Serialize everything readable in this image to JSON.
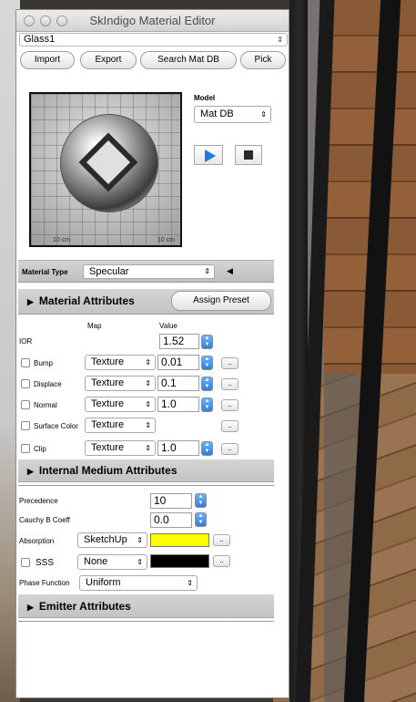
{
  "window": {
    "title": "SkIndigo Material Editor"
  },
  "material_select": {
    "value": "Glass1"
  },
  "toolbar": {
    "import": "Import",
    "export": "Export",
    "search": "Search Mat DB",
    "pick": "Pick"
  },
  "preview": {
    "ruler_left": "10 cm",
    "ruler_right": "10 cm"
  },
  "model": {
    "label": "Model",
    "value": "Mat DB"
  },
  "material_type": {
    "label": "Material Type",
    "value": "Specular"
  },
  "sections": {
    "material_attributes": "Material Attributes",
    "assign_preset": "Assign Preset",
    "internal_medium": "Internal Medium Attributes",
    "emitter": "Emitter Attributes"
  },
  "columns": {
    "map": "Map",
    "value": "Value"
  },
  "ior": {
    "label": "IOR",
    "value": "1.52"
  },
  "attributes": [
    {
      "label": "Bump",
      "map": "Texture",
      "value": "0.01"
    },
    {
      "label": "Displace",
      "map": "Texture",
      "value": "0.1"
    },
    {
      "label": "Normal",
      "map": "Texture",
      "value": "1.0"
    },
    {
      "label": "Surface Color",
      "map": "Texture",
      "value": ""
    },
    {
      "label": "Clip",
      "map": "Texture",
      "value": "1.0"
    }
  ],
  "medium": {
    "precedence": {
      "label": "Precedence",
      "value": "10"
    },
    "cauchy": {
      "label": "Cauchy B Coeff",
      "value": "0.0"
    },
    "absorption": {
      "label": "Absorption",
      "map": "SketchUp",
      "color": "#ffff00"
    },
    "sss": {
      "label": "SSS",
      "map": "None",
      "color": "#000000"
    },
    "phase": {
      "label": "Phase Function",
      "value": "Uniform"
    }
  },
  "dots_label": ".."
}
